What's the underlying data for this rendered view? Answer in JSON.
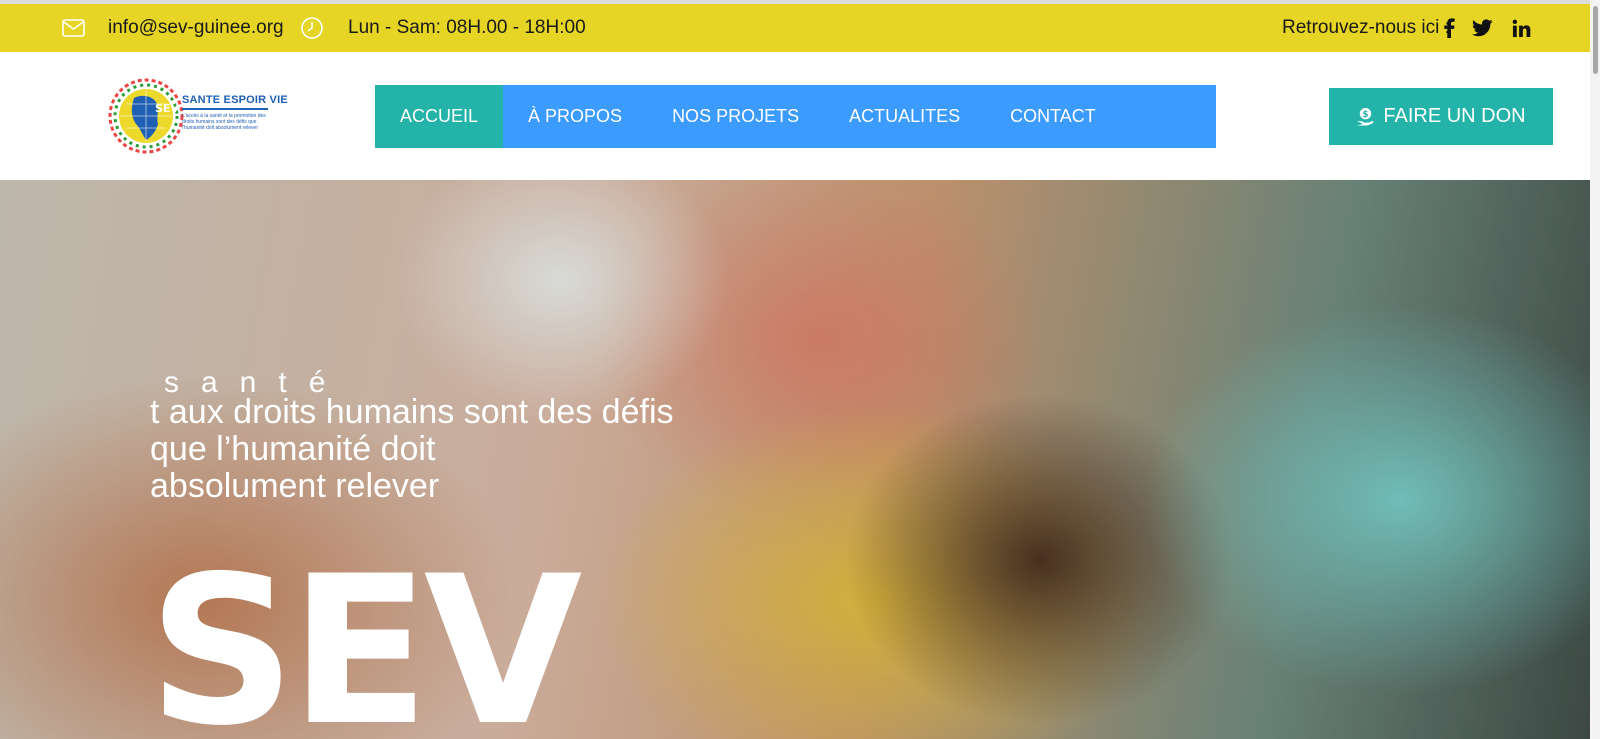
{
  "topbar": {
    "email": "info@sev-guinee.org",
    "hours": "Lun - Sam: 08H.00 - 18H:00",
    "social_label": "Retrouvez-nous ici :",
    "social_icons": [
      "facebook-icon",
      "twitter-icon",
      "linkedin-icon"
    ],
    "background_color": "#e6d524"
  },
  "logo": {
    "title": "SANTE ESPOIR VIE",
    "subtitle": "L'accès à la santé et la promotion des droits humains sont des défis que l'humanité doit absolument relever",
    "globe_text": "SEV"
  },
  "nav": {
    "items": [
      {
        "label": "ACCUEIL",
        "active": true
      },
      {
        "label": "À PROPOS",
        "active": false
      },
      {
        "label": "NOS PROJETS",
        "active": false
      },
      {
        "label": "ACTUALITES",
        "active": false
      },
      {
        "label": "CONTACT",
        "active": false
      }
    ],
    "background_color": "#3b9bff",
    "active_color": "#23b3a8"
  },
  "donate_button": {
    "label": "FAIRE UN DON",
    "icon": "donation-icon",
    "background_color": "#23b3a8"
  },
  "hero": {
    "line1": "santé",
    "line2": "t aux droits humains sont des défis",
    "line3": "que l’humanité doit",
    "line4": "absolument relever",
    "title": "SEV"
  }
}
